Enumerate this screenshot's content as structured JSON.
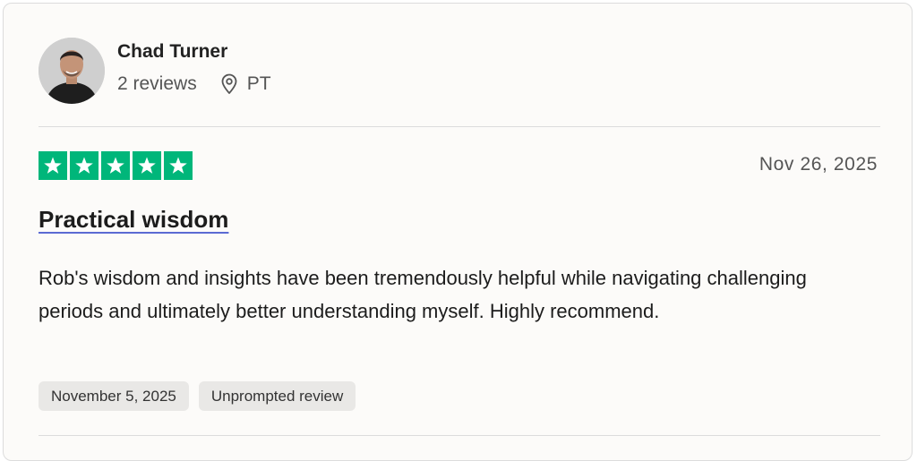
{
  "reviewer": {
    "name": "Chad Turner",
    "reviews_count": "2 reviews",
    "location": "PT",
    "avatar_icon": "reviewer-avatar-photo",
    "location_icon": "map-pin-icon"
  },
  "review": {
    "rating": 5,
    "rating_max": 5,
    "star_color": "#00b67a",
    "date": "Nov 26, 2025",
    "title": "Practical wisdom",
    "body": "Rob's wisdom and insights have been tremendously helpful while navigating challenging periods and ultimately better understanding myself. Highly recommend.",
    "tags": [
      "November 5, 2025",
      "Unprompted review"
    ]
  }
}
